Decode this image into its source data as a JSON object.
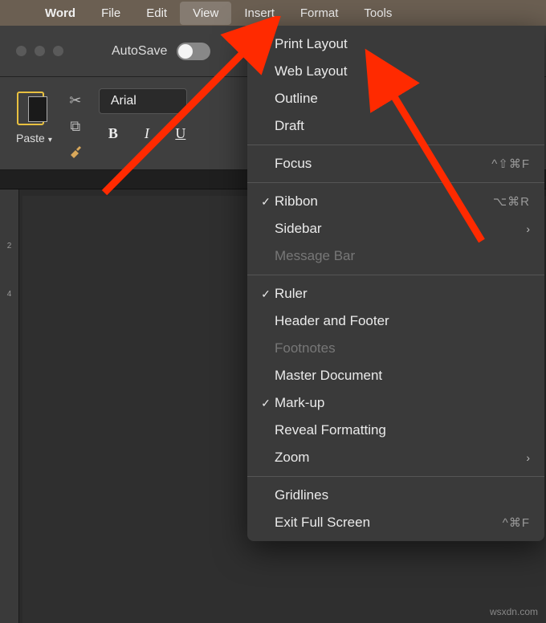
{
  "menubar": {
    "app_name": "Word",
    "items": [
      "File",
      "Edit",
      "View",
      "Insert",
      "Format",
      "Tools"
    ],
    "active_index": 2
  },
  "toolbar": {
    "autosave_label": "AutoSave"
  },
  "ribbon": {
    "paste_label": "Paste",
    "font_name": "Arial",
    "bold": "B",
    "italic": "I",
    "underline": "U"
  },
  "ruler_numbers": [
    "2",
    "4"
  ],
  "view_menu": {
    "groups": [
      [
        {
          "label": "Print Layout",
          "checked": true
        },
        {
          "label": "Web Layout",
          "checked": false
        },
        {
          "label": "Outline",
          "checked": false
        },
        {
          "label": "Draft",
          "checked": false
        }
      ],
      [
        {
          "label": "Focus",
          "checked": false,
          "shortcut": "^⇧⌘F"
        }
      ],
      [
        {
          "label": "Ribbon",
          "checked": true,
          "shortcut": "⌥⌘R"
        },
        {
          "label": "Sidebar",
          "checked": false,
          "submenu": true
        },
        {
          "label": "Message Bar",
          "checked": false,
          "disabled": true
        }
      ],
      [
        {
          "label": "Ruler",
          "checked": true
        },
        {
          "label": "Header and Footer",
          "checked": false
        },
        {
          "label": "Footnotes",
          "checked": false,
          "disabled": true
        },
        {
          "label": "Master Document",
          "checked": false
        },
        {
          "label": "Mark-up",
          "checked": true
        },
        {
          "label": "Reveal Formatting",
          "checked": false
        },
        {
          "label": "Zoom",
          "checked": false,
          "submenu": true
        }
      ],
      [
        {
          "label": "Gridlines",
          "checked": false
        },
        {
          "label": "Exit Full Screen",
          "checked": false,
          "shortcut": "^⌘F"
        }
      ]
    ]
  },
  "watermark": "wsxdn.com"
}
